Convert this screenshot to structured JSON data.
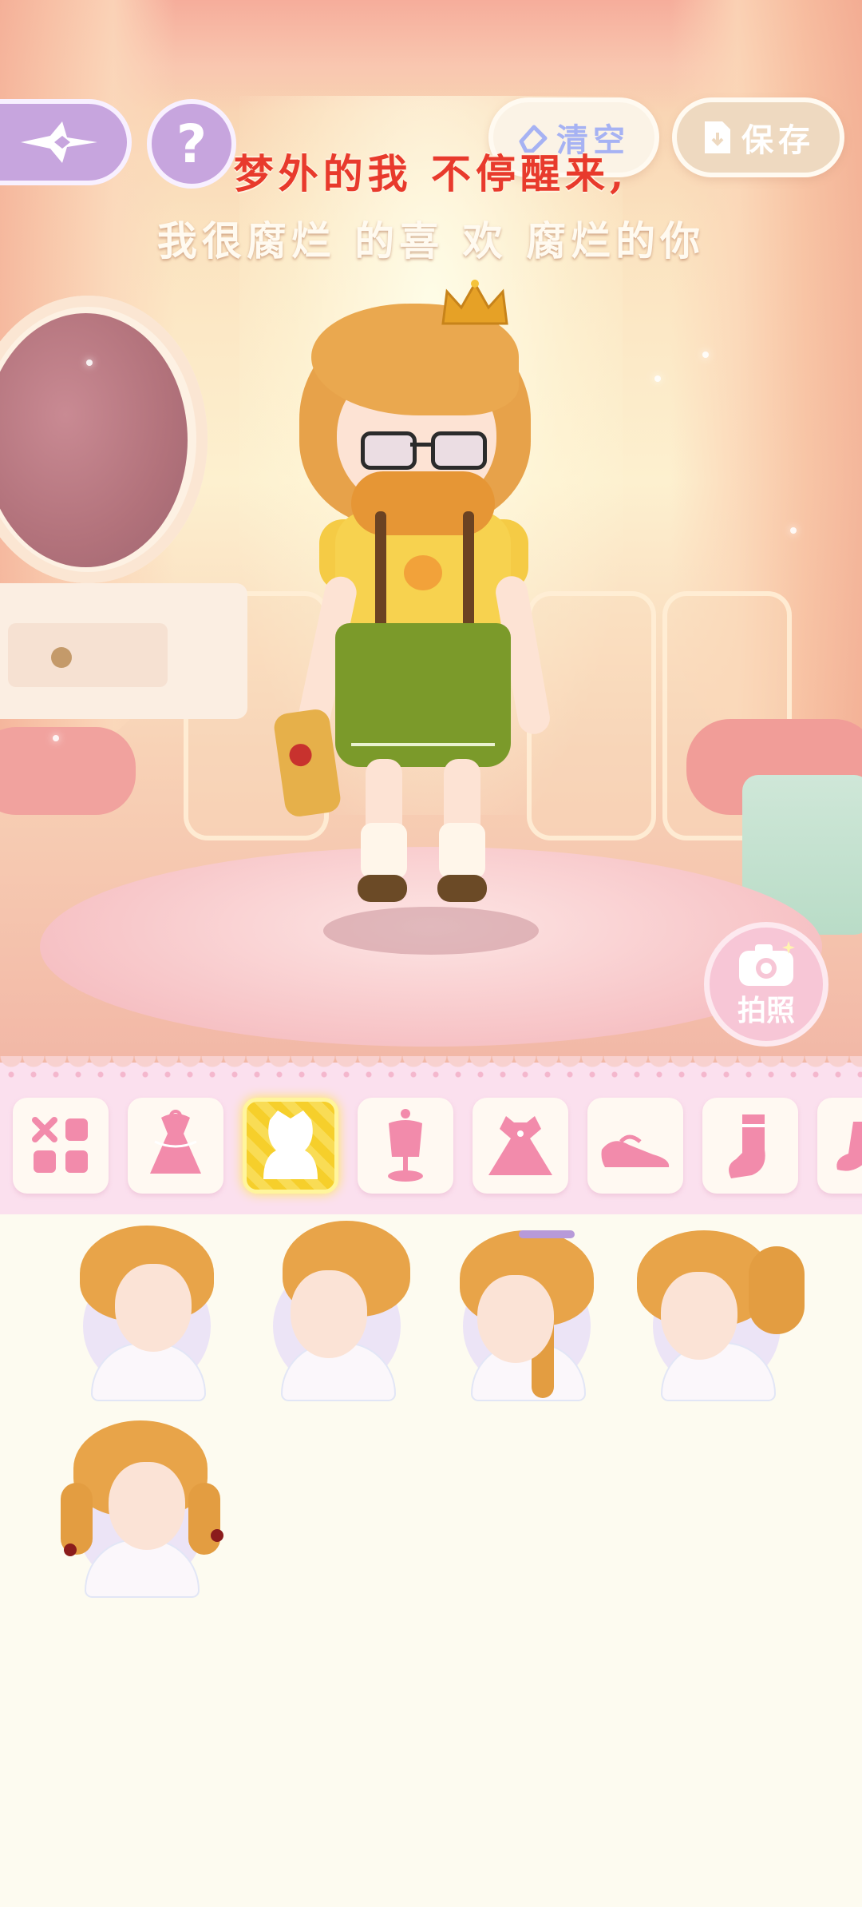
{
  "top_bar": {
    "back_icon": "sparkle-arrow-left-icon",
    "help_label": "?",
    "clear_label": "清空",
    "save_label": "保存"
  },
  "lyrics": {
    "line1": "梦外的我 不停醒来,",
    "line2": "我很腐烂 的喜 欢 腐烂的你"
  },
  "camera": {
    "label": "拍照",
    "icon": "camera-icon"
  },
  "categories": [
    {
      "id": "all",
      "icon": "grid-icon",
      "active": false
    },
    {
      "id": "outfit-set",
      "icon": "dress-set-icon",
      "active": false
    },
    {
      "id": "hair",
      "icon": "hair-silhouette-icon",
      "active": true
    },
    {
      "id": "top",
      "icon": "mannequin-icon",
      "active": false
    },
    {
      "id": "dress",
      "icon": "dress-icon",
      "active": false
    },
    {
      "id": "shoes",
      "icon": "shoe-icon",
      "active": false
    },
    {
      "id": "socks",
      "icon": "sock-icon",
      "active": false
    },
    {
      "id": "more",
      "icon": "partial-icon",
      "active": false
    }
  ],
  "hair_items": [
    {
      "style": "short-swept"
    },
    {
      "style": "slicked-back"
    },
    {
      "style": "braided-headband"
    },
    {
      "style": "side-ponytail"
    },
    {
      "style": "twin-braids-red-bows"
    }
  ],
  "colors": {
    "accent_purple": "#c7a5de",
    "active_tab": "#f6cf2b",
    "lyric_red": "#e83a2c",
    "hair_orange": "#e8a449",
    "pink_icon": "#f28bab"
  }
}
